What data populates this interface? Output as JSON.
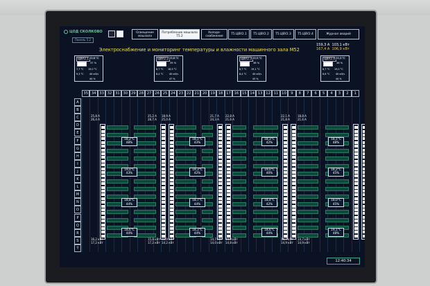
{
  "header": {
    "logo_text": "ЦОД СКОЛКОВО",
    "panel_label": "Панель 5.2",
    "tabs": [
      {
        "label": "Освещение машзала",
        "active": false
      },
      {
        "label": "Потребление машзала Т5.2",
        "active": true
      },
      {
        "label": "Холодо-снабжение",
        "active": false
      },
      {
        "label": "Т5.ЦВУ2.1",
        "active": false
      },
      {
        "label": "Т5.ЦВУ2.2",
        "active": false
      },
      {
        "label": "Т5.ЦВУ2.3",
        "active": false
      },
      {
        "label": "Т5.ЦВУ2.4",
        "active": false
      },
      {
        "label": "Журнал аварий",
        "active": false
      }
    ],
    "stats": {
      "a1": "159,3 А",
      "kw1": "103,1 кВт",
      "a2": "167,4 А",
      "kw2": "106,9 кВт"
    }
  },
  "title": "Электроснабжение и мониторинг температуры и влажности машинного зала М52",
  "sensors": [
    {
      "name": "ЦВУ2.1",
      "t": "23,8 °С",
      "h": "37 %",
      "in_t": "7,7 °С",
      "in_t2": "19,0 °С",
      "out_t": "9,3 °С",
      "flow": "40 м3/ч",
      "hum2": "44 %"
    },
    {
      "name": "ЦВУ2.2",
      "t": "23,8 °С",
      "h": "39 %",
      "in_t": "6,7 °С",
      "in_t2": "18,9 °С",
      "out_t": "8,4 °С",
      "flow": "40 м3/ч",
      "hum2": "47 %"
    },
    {
      "name": "ЦВУ2.3",
      "t": "23,9 °С",
      "h": "38 %",
      "in_t": "6,7 °С",
      "in_t2": "19,1 °С",
      "out_t": "8,4 °С",
      "flow": "40 м3/ч",
      "hum2": "45 %"
    },
    {
      "name": "ЦВУ2.4",
      "t": "23,3 °С",
      "h": "36 %",
      "in_t": "6,7 °С",
      "in_t2": "19,0 °С",
      "out_t": "8,6 °С",
      "flow": "40 м3/ч",
      "hum2": "44 %"
    }
  ],
  "columns": [
    "35",
    "34",
    "33",
    "32",
    "31",
    "30",
    "29",
    "28",
    "27",
    "26",
    "25",
    "24",
    "23",
    "22",
    "21",
    "20",
    "19",
    "18",
    "17",
    "16",
    "15",
    "14",
    "13",
    "12",
    "11",
    "10",
    "9",
    "8",
    "7",
    "6",
    "5",
    "4",
    "3",
    "2",
    "1"
  ],
  "rows": [
    "A",
    "B",
    "C",
    "D",
    "E",
    "F",
    "G",
    "H",
    "I",
    "J",
    "K",
    "L",
    "M",
    "N",
    "O",
    "P",
    "Q",
    "R",
    "S",
    "T"
  ],
  "top_currents": [
    {
      "l1": "25,8 А",
      "l2": "26,4 А"
    },
    {
      "l1": "25,2 А",
      "l2": "28,7 А",
      "r1": "18,9 А",
      "r2": "25,0 А"
    },
    {
      "l1": "21,7 А",
      "l2": "24,3 А",
      "r1": "22,8 А",
      "r2": "21,6 А"
    },
    {
      "l1": "22,1 А",
      "l2": "21,8 А",
      "r1": "18,8 А",
      "r2": "21,6 А"
    }
  ],
  "bottom_power": [
    {
      "l1": "16,2 кВт",
      "l2": "17,2 кВт"
    },
    {
      "l1": "15,8 кВт",
      "l2": "17,2 кВт",
      "r1": "11,9 кВт",
      "r2": "14,2 кВт"
    },
    {
      "l1": "14,7 кВт",
      "l2": "14,0 кВт",
      "r1": "14,9 кВт",
      "r2": "14,8 кВт"
    },
    {
      "l1": "14,7 кВт",
      "l2": "14,9 кВт",
      "r1": "14,7 кВт",
      "r2": "14,9 кВт"
    }
  ],
  "cells": [
    [
      {
        "t": "18,2°C",
        "h": "48%"
      },
      {
        "t": "18,5°C",
        "h": "43%"
      },
      {
        "t": "18,3°C",
        "h": "42%"
      },
      {
        "t": "18,1°C",
        "h": "48%"
      }
    ],
    [
      {
        "t": "19,0°C",
        "h": "43%"
      },
      {
        "t": "19,3°C",
        "h": "42%"
      },
      {
        "t": "19,0°C",
        "h": "40%"
      },
      {
        "t": "18,2°C",
        "h": "45%"
      }
    ],
    [
      {
        "t": "18,8°C",
        "h": "44%"
      },
      {
        "t": "18,7°C",
        "h": "44%"
      },
      {
        "t": "18,4°C",
        "h": "42%"
      },
      {
        "t": "18,0°C",
        "h": "45%"
      }
    ],
    [
      {
        "t": "18,6°C",
        "h": "44%"
      },
      {
        "t": "18,3°C",
        "h": "44%"
      },
      {
        "t": "18,6°C",
        "h": "44%"
      },
      {
        "t": "19,1°C",
        "h": "48%"
      }
    ]
  ],
  "clock": "12:40:34"
}
